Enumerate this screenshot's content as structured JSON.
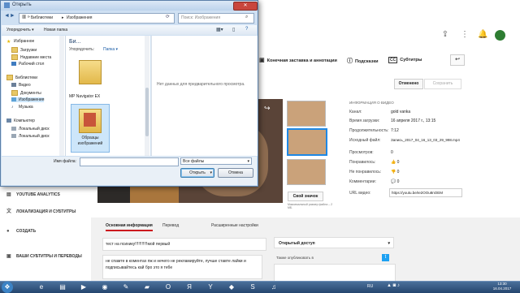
{
  "dialog": {
    "title": "Открыть",
    "close_glyph": "✕",
    "minimize_glyph": "—",
    "maximize_glyph": "□",
    "breadcrumb": [
      "Библиотеки",
      "Изображения"
    ],
    "search_placeholder": "Поиск: Изображения",
    "toolbar": {
      "organize": "Упорядочить ▾",
      "new_folder": "Новая папка"
    },
    "nav": {
      "favorites": "Избранное",
      "downloads": "Загрузки",
      "recent": "Недавние места",
      "desktop": "Рабочий стол",
      "libraries": "Библиотеки",
      "video": "Видео",
      "documents": "Документы",
      "images": "Изображения",
      "music": "Музыка",
      "computer": "Компьютер",
      "local_disk_1": "Локальный диск",
      "local_disk_2": "Локальный диск"
    },
    "file_pane": {
      "library_title": "Би...",
      "arrange_label": "Упорядочить:",
      "arrange_value": "Папка ▾",
      "items": [
        {
          "label": "MP Navigator EX"
        },
        {
          "label": "Образцы изображений"
        }
      ]
    },
    "preview_text": "Нет данных для предварительного просмотра.",
    "filename_label": "Имя файла:",
    "filename_value": "",
    "filetype_value": "Все файлы",
    "open_button": "Открыть",
    "cancel_button": "Отмена"
  },
  "youtube": {
    "tools_tabs": [
      {
        "icon": "▣",
        "label": "Конечная заставка и аннотации"
      },
      {
        "icon": "ⓘ",
        "label": "Подсказки"
      },
      {
        "icon": "CC",
        "label": "Субтитры"
      }
    ],
    "published_button": "Отменено",
    "save_button": "Сохранить",
    "info_header": "ИНФОРМАЦИЯ О ВИДЕО",
    "info": [
      {
        "label": "Канал:",
        "value": "gold vanka"
      },
      {
        "label": "Время загрузки:",
        "value": "16 апреля 2017 г., 13:15"
      },
      {
        "label": "Продолжительность:",
        "value": "7:12"
      },
      {
        "label": "Исходный файл:",
        "value": "Запись_2017_04_16_13_03_29_998.mp4"
      }
    ],
    "stats": [
      {
        "label": "Просмотров:",
        "value": "0"
      },
      {
        "label": "Понравилось:",
        "value": "0"
      },
      {
        "label": "Не понравилось:",
        "value": "0"
      },
      {
        "label": "Комментарии:",
        "value": "0"
      }
    ],
    "url_label": "URL видео:",
    "url_value": "https://youtu.be/Ie2OOu8nOEM",
    "custom_thumb_button": "Свой значок",
    "thumb_note": "Максимальный размер файла – 2 МБ.",
    "tabs": [
      "Основная информация",
      "Перевод",
      "Расширенные настройки"
    ],
    "title_value": "тест на психику!!!!!!!!!!!мой первый",
    "description_value": "не спамте в коментах пж и нечего не рекламируйте, лучше ставте лайки и подписывайтесь кай бро это я тебе",
    "access_title": "Открытый доступ",
    "share_label": "Также опубликовать в",
    "sidebar": [
      {
        "icon": "▤",
        "label": "YOUTUBE ANALYTICS"
      },
      {
        "icon": "文",
        "label": "ЛОКАЛИЗАЦИЯ И СУБТИТРЫ"
      },
      {
        "icon": "●",
        "label": "СОЗДАТЬ"
      },
      {
        "icon": "▣",
        "label": "ВАШИ СУБТИТРЫ И ПЕРЕВОДЫ"
      }
    ],
    "back_glyph": "↩"
  },
  "taskbar": {
    "lang": "RU",
    "time": "13:30",
    "date": "16.04.2017"
  },
  "colors": {
    "taskbar": "#25456e",
    "dialog_frame": "#cfe0f2",
    "accent": "#1e88e5"
  }
}
